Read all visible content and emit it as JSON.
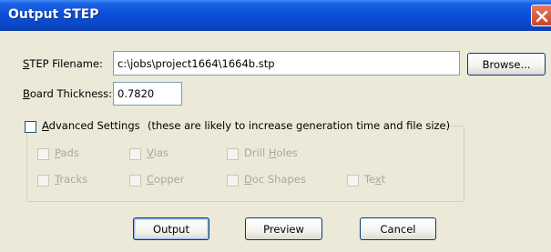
{
  "window": {
    "title": "Output STEP"
  },
  "step_filename": {
    "label_char": "S",
    "label_rest": "TEP Filename:",
    "value": "c:\\jobs\\project1664\\1664b.stp",
    "browse_label": "Browse..."
  },
  "board_thickness": {
    "label_char": "B",
    "label_rest": "oard Thickness:",
    "value": "0.7820"
  },
  "advanced": {
    "label_char": "A",
    "label_rest": "dvanced Settings",
    "note": "(these are likely to increase generation time and file size)",
    "checked": false,
    "options": {
      "pads": {
        "u": "P",
        "rest": "ads",
        "enabled": false
      },
      "vias": {
        "u": "V",
        "rest": "ias",
        "enabled": false
      },
      "drill": {
        "pre": "Drill ",
        "u": "H",
        "rest": "oles",
        "enabled": false
      },
      "tracks": {
        "u": "T",
        "rest": "racks",
        "enabled": false
      },
      "copper": {
        "u": "C",
        "rest": "opper",
        "enabled": false
      },
      "doc": {
        "u": "D",
        "rest": "oc Shapes",
        "enabled": false
      },
      "text": {
        "pre": "Te",
        "u": "x",
        "rest": "t",
        "enabled": false
      }
    }
  },
  "buttons": {
    "output": "Output",
    "preview": "Preview",
    "cancel": "Cancel"
  },
  "colors": {
    "titlebar": "#0a4fd8",
    "face": "#ece9d8",
    "close": "#c74527"
  }
}
